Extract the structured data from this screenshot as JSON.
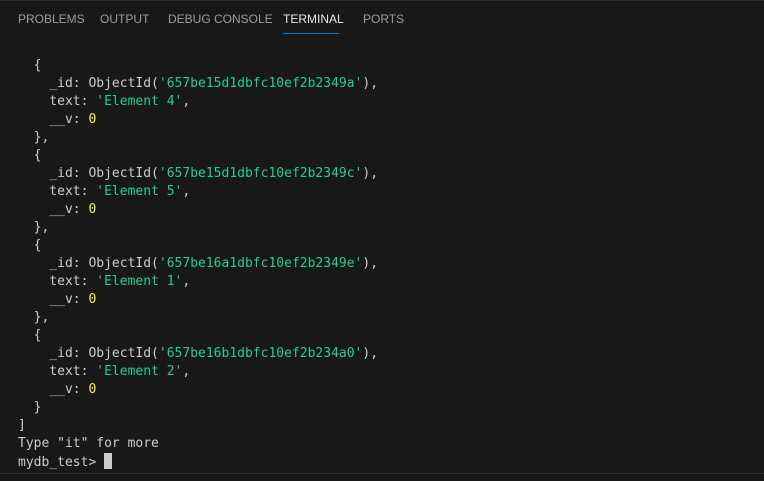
{
  "tabs": [
    {
      "label": "PROBLEMS"
    },
    {
      "label": "OUTPUT"
    },
    {
      "label": "DEBUG CONSOLE"
    },
    {
      "label": "TERMINAL"
    },
    {
      "label": "PORTS"
    }
  ],
  "active_tab": "TERMINAL",
  "terminal": {
    "docs": [
      {
        "id": "657be15d1dbfc10ef2b2349a",
        "text": "Element 4",
        "v": "0"
      },
      {
        "id": "657be15d1dbfc10ef2b2349c",
        "text": "Element 5",
        "v": "0"
      },
      {
        "id": "657be16a1dbfc10ef2b2349e",
        "text": "Element 1",
        "v": "0"
      },
      {
        "id": "657be16b1dbfc10ef2b234a0",
        "text": "Element 2",
        "v": "0"
      }
    ],
    "more_hint": "Type \"it\" for more",
    "prompt": "mydb_test>"
  },
  "colors": {
    "background": "#181818",
    "string": "#23d18b",
    "number": "#f5f543",
    "text": "#cccccc",
    "active_tab_underline": "#0078d4"
  }
}
